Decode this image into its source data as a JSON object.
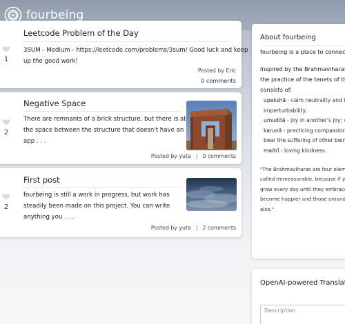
{
  "header": {
    "brand": "fourbeing",
    "logo_icon": "mandala-logo-icon"
  },
  "feed": {
    "posts": [
      {
        "title": "Leetcode Problem of the Day",
        "body_lines": [
          "3SUM - Medium - https://leetcode.com/problems/3sum/ Good luck and keep",
          "up the good work!"
        ],
        "votes": "1",
        "meta": "Posted by Eric",
        "comments": "0 comments",
        "has_thumbnail": false
      },
      {
        "title": "Negative Space",
        "body_lines": [
          "There are remnants of a brick structure, but there is also",
          "the space between the structure that doesn't have an",
          "app . . ."
        ],
        "votes": "2",
        "meta": "Posted by yuta",
        "comments": "0 comments",
        "has_thumbnail": true,
        "thumbnail": "brick-ruin-image"
      },
      {
        "title": "First post",
        "body_lines": [
          "fourbeing is still a work in progress, but work has",
          "steadily been made on this project. You can write",
          "anything you . . ."
        ],
        "votes": "2",
        "meta": "Posted by yuta",
        "comments": "2 comments",
        "has_thumbnail": true,
        "thumbnail": "cloudy-sky-image"
      }
    ],
    "separator": "|"
  },
  "sidebar": {
    "about": {
      "title": "About fourbeing",
      "intro": "fourbeing is a place to connect",
      "para_lines": [
        "Inspired by the Brahmaviharas",
        "the practice of the tenets of th",
        "consists of:"
      ],
      "list_lines": [
        {
          "term": "upekshā",
          "desc": " - calm neutrality and i"
        },
        {
          "term": "",
          "desc": "imperturbability."
        },
        {
          "term": "umuditā",
          "desc": " - joy in another's joy; c"
        },
        {
          "term": "karunā",
          "desc": " - practicing compassion"
        },
        {
          "term": "",
          "desc": "bear the suffering of other beings"
        },
        {
          "term": "maitrī",
          "desc": " - loving kindness."
        }
      ],
      "quote_lines": [
        "\"The Brahmaviharas are four eleme",
        "called Immeasurable, because if yo",
        "grow every day until they embrace",
        "become happier and those around",
        "also.\""
      ]
    },
    "translator": {
      "title": "OpenAI-powered Translato",
      "description_placeholder": "Description"
    }
  }
}
